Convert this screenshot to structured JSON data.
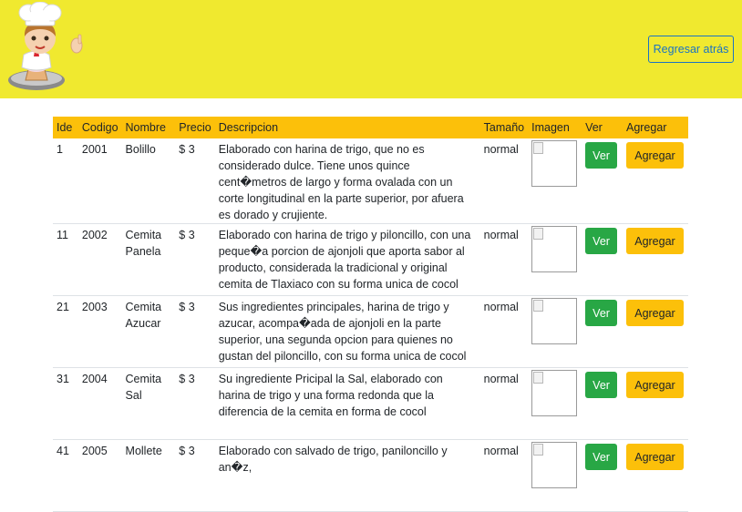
{
  "header": {
    "back_label": "Regresar atrás",
    "colors": {
      "background": "#f0e92f",
      "accent": "#1a73c4"
    },
    "logo_icon": "chef-cupcake-logo"
  },
  "table": {
    "columns": [
      "Ide",
      "Codigo",
      "Nombre",
      "Precio",
      "Descripcion",
      "Tamaño",
      "Imagen",
      "Ver",
      "Agregar"
    ],
    "header_color": "#fcc00a",
    "rows": [
      {
        "ide": "1",
        "codigo": "2001",
        "nombre": "Bolillo",
        "precio": "$ 3",
        "descripcion": "Elaborado con harina de trigo, que no es considerado dulce. Tiene unos quince cent�metros de largo y forma ovalada con un corte longitudinal en la parte superior, por afuera es dorado y crujiente.",
        "tamano": "normal",
        "ver_label": "Ver",
        "agregar_label": "Agregar"
      },
      {
        "ide": "11",
        "codigo": "2002",
        "nombre": "Cemita Panela",
        "precio": "$ 3",
        "descripcion": "Elaborado con harina de trigo y piloncillo, con una peque�a porcion de ajonjoli que aporta sabor al producto, considerada la tradicional y original cemita de Tlaxiaco con su forma unica de cocol",
        "tamano": "normal",
        "ver_label": "Ver",
        "agregar_label": "Agregar"
      },
      {
        "ide": "21",
        "codigo": "2003",
        "nombre": "Cemita Azucar",
        "precio": "$ 3",
        "descripcion": "Sus ingredientes principales, harina de trigo y azucar, acompa�ada de ajonjoli en la parte superior, una segunda opcion para quienes no gustan del piloncillo, con su forma unica de cocol",
        "tamano": "normal",
        "ver_label": "Ver",
        "agregar_label": "Agregar"
      },
      {
        "ide": "31",
        "codigo": "2004",
        "nombre": "Cemita Sal",
        "precio": "$ 3",
        "descripcion": "Su ingrediente Pricipal la Sal, elaborado con harina de trigo y una forma redonda que la diferencia de la cemita en forma de cocol",
        "tamano": "normal",
        "ver_label": "Ver",
        "agregar_label": "Agregar"
      },
      {
        "ide": "41",
        "codigo": "2005",
        "nombre": "Mollete",
        "precio": "$ 3",
        "descripcion": "Elaborado con salvado de trigo, paniloncillo y an�z,",
        "tamano": "normal",
        "ver_label": "Ver",
        "agregar_label": "Agregar"
      }
    ],
    "button_colors": {
      "ver": "#28a745",
      "agregar": "#fcc00a"
    }
  }
}
